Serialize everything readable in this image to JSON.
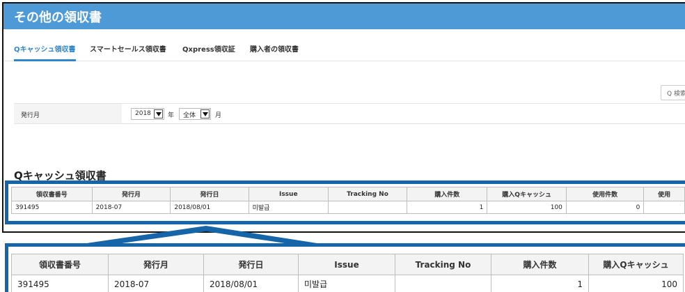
{
  "header": {
    "title": "その他の領収書"
  },
  "tabs": [
    {
      "label": "Qキャッシュ領収書",
      "active": true
    },
    {
      "label": "スマートセールス領収書",
      "active": false
    },
    {
      "label": "Qxpress領収証",
      "active": false
    },
    {
      "label": "購入者の領収書",
      "active": false
    }
  ],
  "search": {
    "label": "Q 検索"
  },
  "filter": {
    "label": "発行月",
    "year_value": "2018",
    "year_unit": "年",
    "month_value": "全体",
    "month_unit": "月"
  },
  "section": {
    "title": "Qキャッシュ領収書"
  },
  "table": {
    "columns": [
      "領収書番号",
      "発行月",
      "発行日",
      "Issue",
      "Tracking No",
      "購入件数",
      "購入Qキャッシュ",
      "使用件数",
      "使用"
    ],
    "rows": [
      [
        "391495",
        "2018-07",
        "2018/08/01",
        "미발급",
        "",
        "1",
        "100",
        "0",
        ""
      ]
    ]
  },
  "colors": {
    "header": "#4d9ad6",
    "accent": "#2f86c9",
    "highlight": "#1565a8"
  }
}
